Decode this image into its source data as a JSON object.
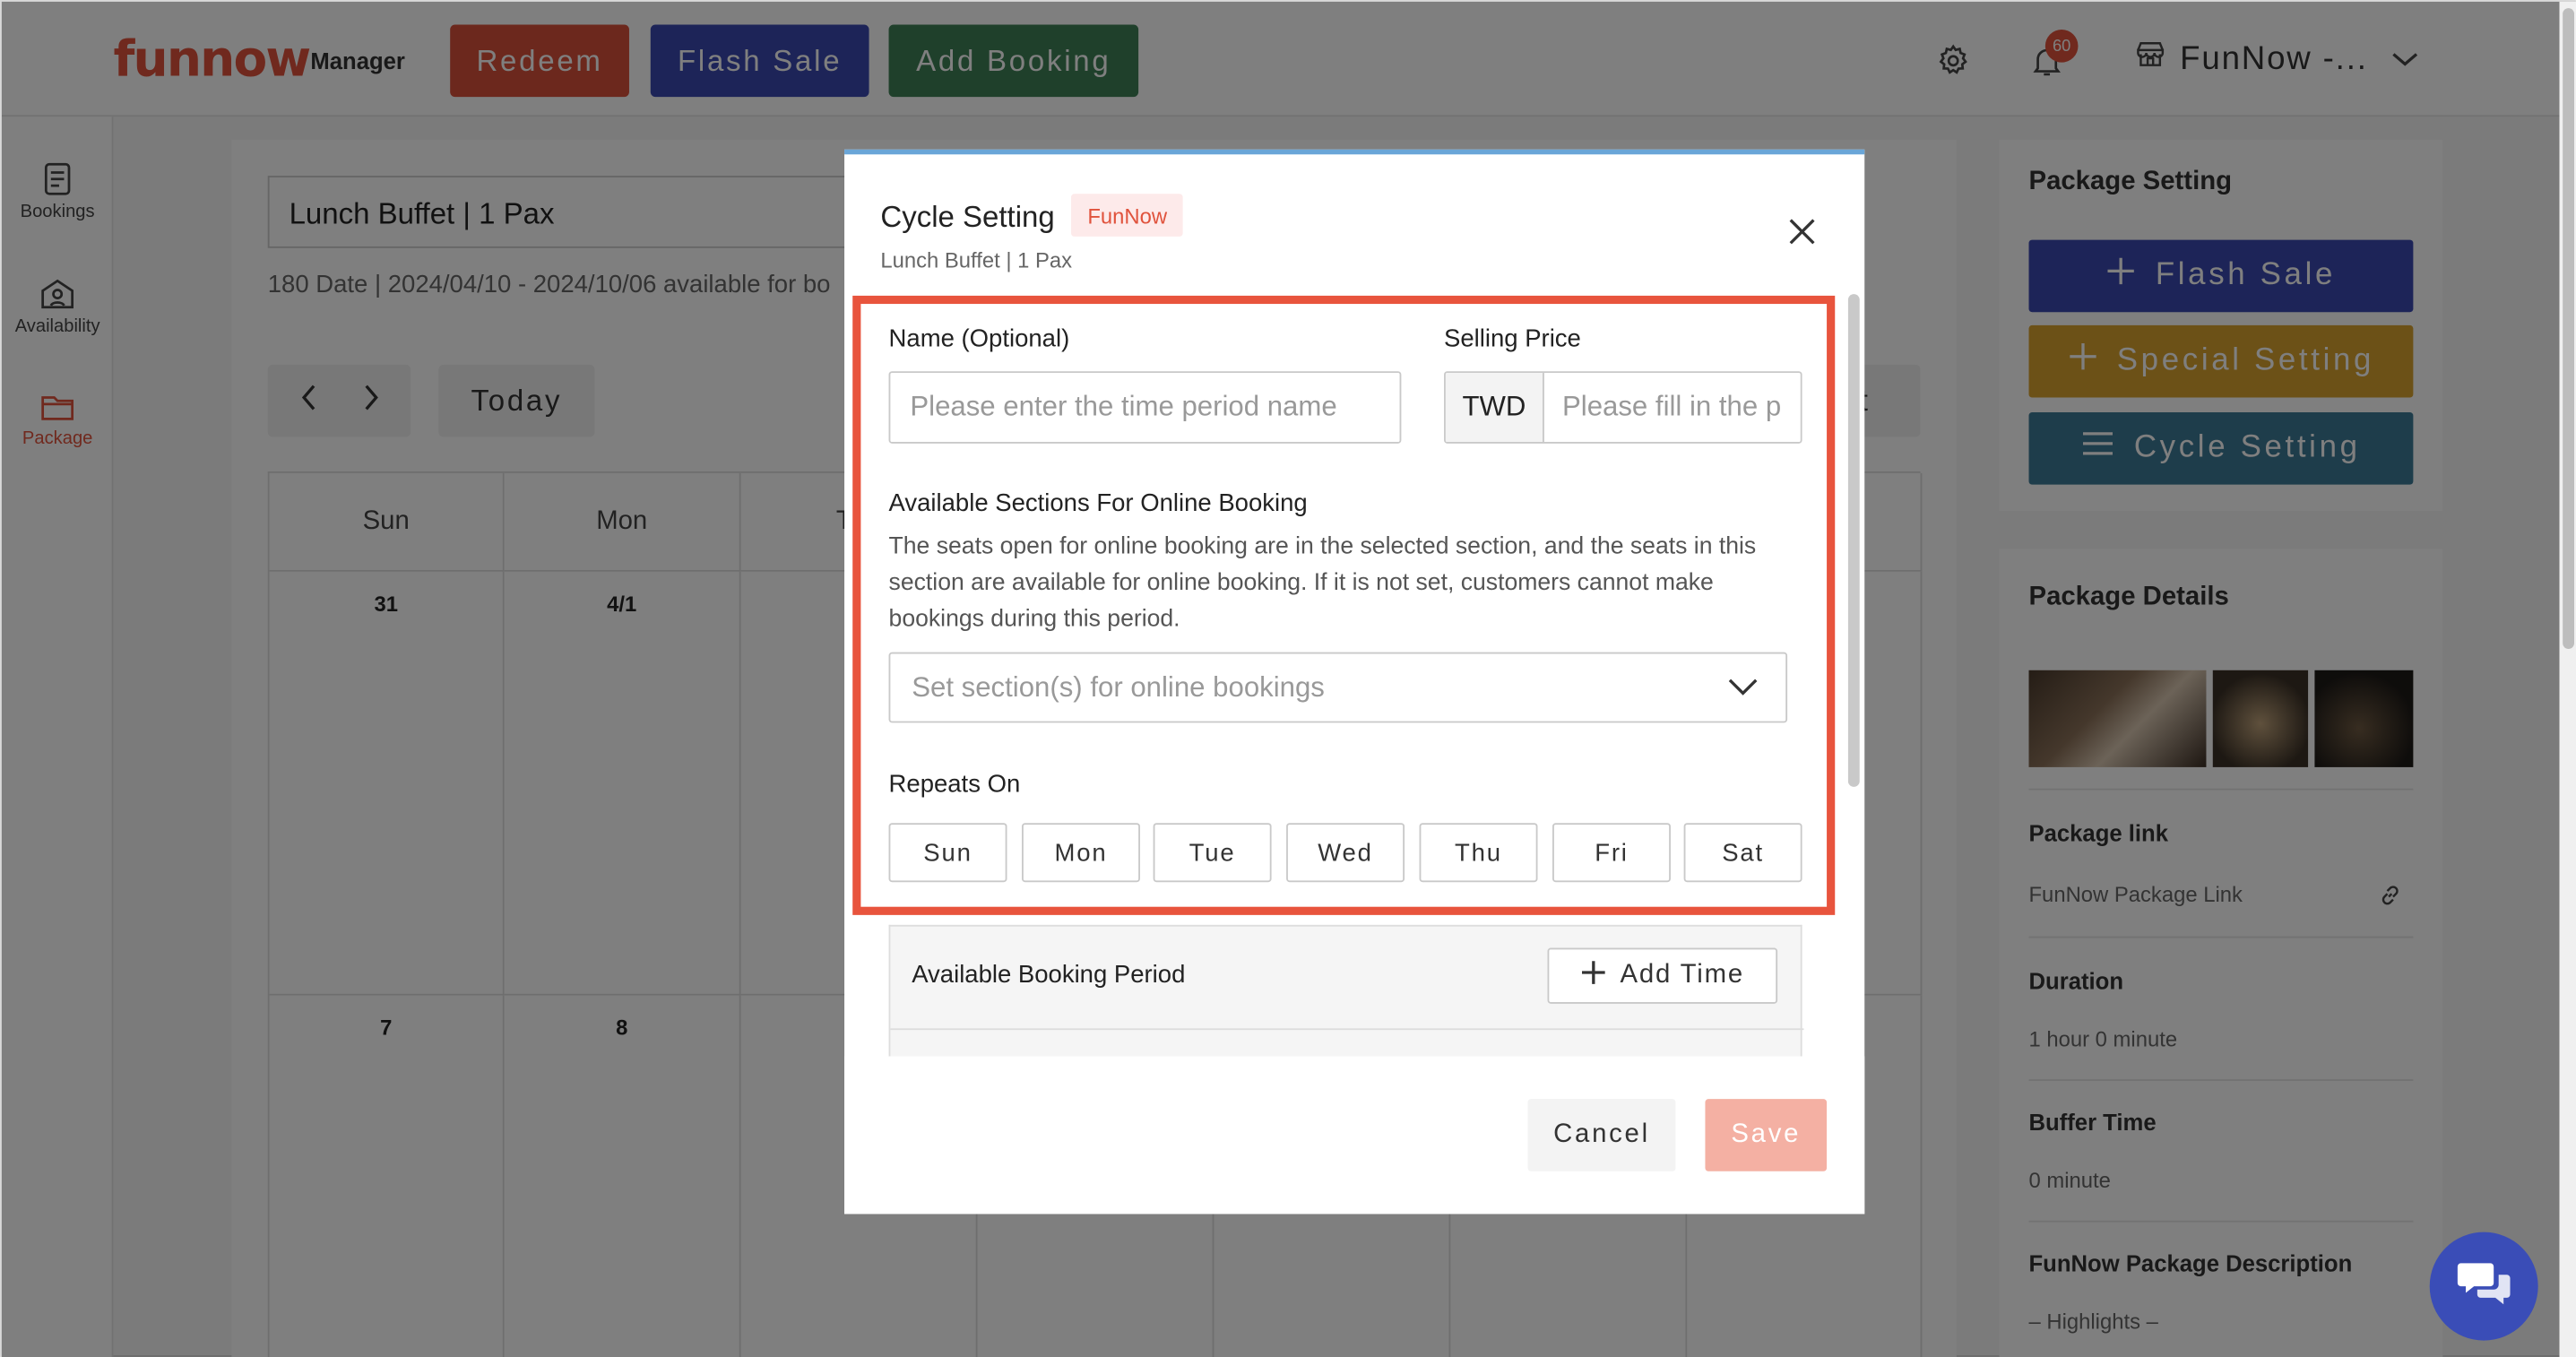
{
  "header": {
    "logo": "funnow",
    "logo_sub": "Manager",
    "buttons": [
      "Redeem",
      "Flash Sale",
      "Add Booking"
    ],
    "notification_count": "60",
    "store_name": "FunNow -...",
    "colors": {
      "redeem": "#d9503b",
      "flash_sale": "#3b49b0",
      "add_booking": "#3f8157"
    }
  },
  "sidebar": {
    "items": [
      {
        "label": "Bookings",
        "icon": "document-icon"
      },
      {
        "label": "Availability",
        "icon": "calendar-user-icon"
      },
      {
        "label": "Package",
        "icon": "folder-icon",
        "active": true
      }
    ]
  },
  "main": {
    "package_select": "Lunch Buffet | 1 Pax",
    "package_info": "180 Date | 2024/04/10 - 2024/10/06 available for bo",
    "today_label": "Today",
    "right_partial_label": "st",
    "calendar": {
      "headers": [
        "Sun",
        "Mon",
        "T"
      ],
      "row1": [
        "31",
        "4/1"
      ],
      "row2": [
        "7",
        "8"
      ]
    }
  },
  "right_panel": {
    "package_setting_title": "Package Setting",
    "buttons": [
      {
        "label": "Flash Sale",
        "color": "#3b49b0",
        "icon": "plus-icon"
      },
      {
        "label": "Special Setting",
        "color": "#d9a32e",
        "icon": "plus-icon"
      },
      {
        "label": "Cycle Setting",
        "color": "#3d7a96",
        "icon": "menu-icon"
      }
    ],
    "package_details_title": "Package Details",
    "package_link_label": "Package link",
    "package_link_value": "FunNow Package Link",
    "duration_label": "Duration",
    "duration_value": "1 hour 0 minute",
    "buffer_label": "Buffer Time",
    "buffer_value": "0 minute",
    "description_label": "FunNow Package Description",
    "description_value": "– Highlights –"
  },
  "modal": {
    "title": "Cycle Setting",
    "tag": "FunNow",
    "subtitle": "Lunch Buffet | 1 Pax",
    "name_label": "Name (Optional)",
    "name_placeholder": "Please enter the time period name",
    "price_label": "Selling Price",
    "currency": "TWD",
    "price_placeholder": "Please fill in the p",
    "sections_label": "Available Sections For Online Booking",
    "sections_desc": "The seats open for online booking are in the selected section, and the seats in this section are available for online booking. If it is not set, customers cannot make bookings during this period.",
    "sections_placeholder": "Set section(s) for online bookings",
    "repeats_label": "Repeats On",
    "days": [
      "Sun",
      "Mon",
      "Tue",
      "Wed",
      "Thu",
      "Fri",
      "Sat"
    ],
    "period_label": "Available Booking Period",
    "add_time_label": "Add Time",
    "cancel_label": "Cancel",
    "save_label": "Save",
    "save_color": "#f4b0a3",
    "highlight_color": "#e8543d"
  }
}
